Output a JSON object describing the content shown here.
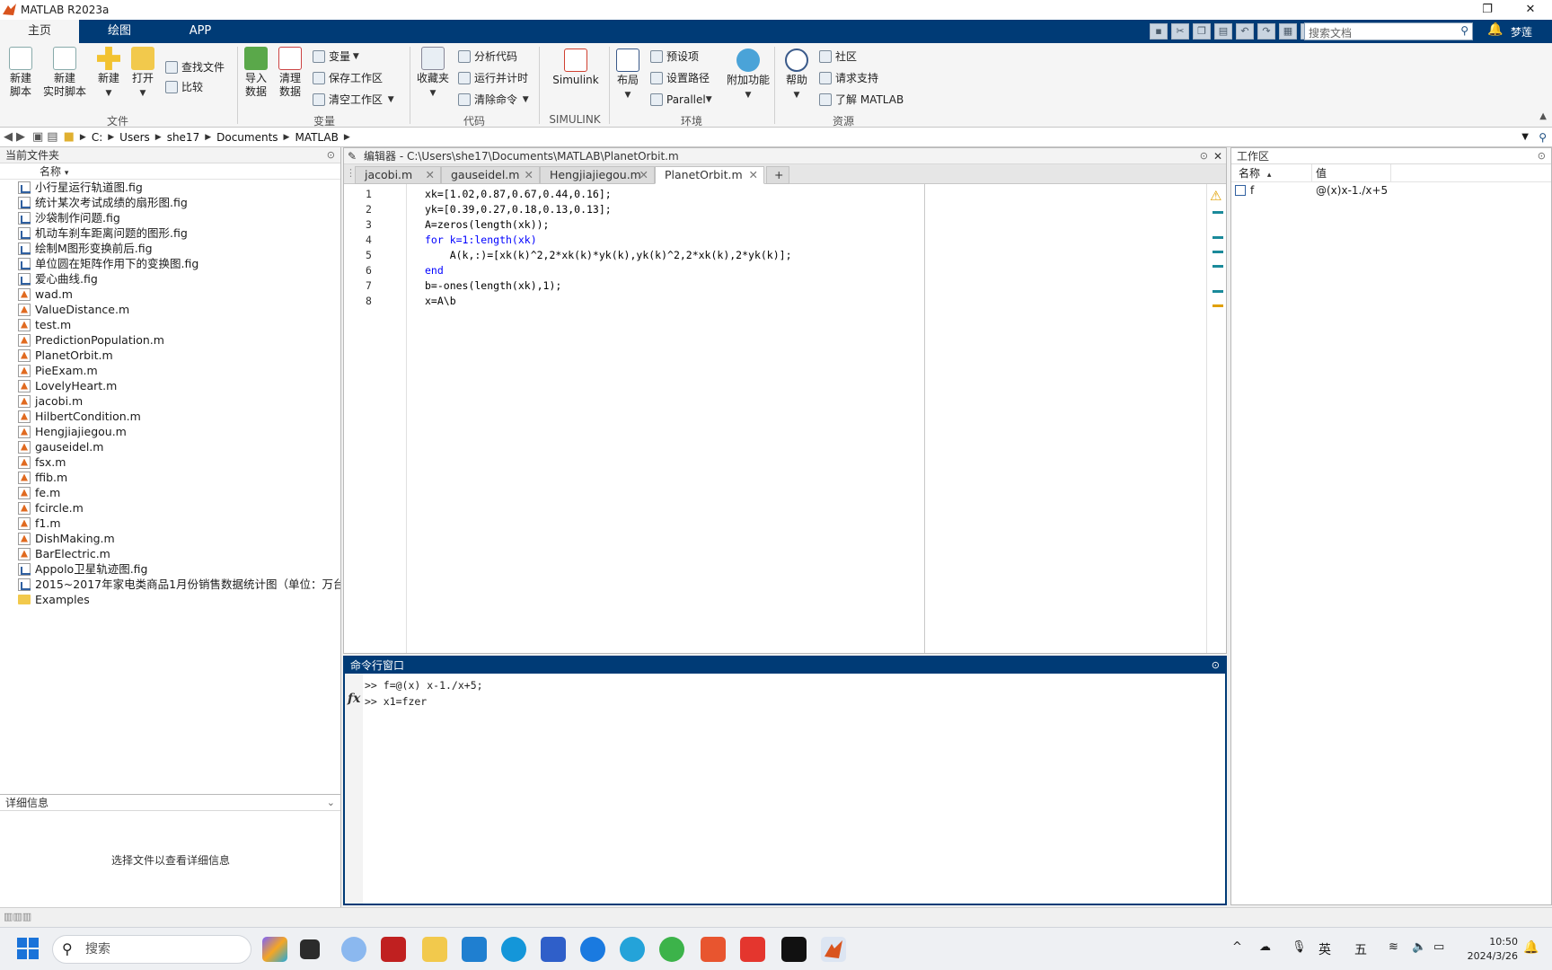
{
  "window": {
    "title": "MATLAB R2023a",
    "restore": "❐",
    "close": "✕"
  },
  "ribbon_tabs": [
    "主页",
    "绘图",
    "APP"
  ],
  "search": {
    "placeholder": "搜索文档"
  },
  "user": "梦莲",
  "ribbon": {
    "new_script": "新建\n脚本",
    "new_live_script": "新建\n实时脚本",
    "new": "新建",
    "open": "打开",
    "find_files": "查找文件",
    "compare": "比较",
    "import_data": "导入\n数据",
    "clean_data": "清理\n数据",
    "variable": "变量",
    "save_workspace": "保存工作区",
    "clear_workspace": "清空工作区",
    "favorites": "收藏夹",
    "analyze_code": "分析代码",
    "run_and_time": "运行并计时",
    "clear_commands": "清除命令",
    "simulink": "Simulink",
    "layout": "布局",
    "preferences": "预设项",
    "set_path": "设置路径",
    "parallel": "Parallel",
    "addons": "附加功能",
    "help": "帮助",
    "community": "社区",
    "request_support": "请求支持",
    "learn_matlab": "了解 MATLAB",
    "groups": {
      "file": "文件",
      "variable": "变量",
      "code": "代码",
      "simulink": "SIMULINK",
      "environment": "环境",
      "resources": "资源"
    }
  },
  "address": {
    "crumbs": [
      "C:",
      "Users",
      "she17",
      "Documents",
      "MATLAB"
    ]
  },
  "file_panel": {
    "title": "当前文件夹",
    "col_name": "名称",
    "files": [
      {
        "name": "小行星运行轨道图.fig",
        "type": "fig"
      },
      {
        "name": "统计某次考试成绩的扇形图.fig",
        "type": "fig"
      },
      {
        "name": "沙袋制作问题.fig",
        "type": "fig"
      },
      {
        "name": "机动车刹车距离问题的图形.fig",
        "type": "fig"
      },
      {
        "name": "绘制M图形变换前后.fig",
        "type": "fig"
      },
      {
        "name": "单位圆在矩阵作用下的变换图.fig",
        "type": "fig"
      },
      {
        "name": "爱心曲线.fig",
        "type": "fig"
      },
      {
        "name": "wad.m",
        "type": "m"
      },
      {
        "name": "ValueDistance.m",
        "type": "m"
      },
      {
        "name": "test.m",
        "type": "m"
      },
      {
        "name": "PredictionPopulation.m",
        "type": "m"
      },
      {
        "name": "PlanetOrbit.m",
        "type": "m"
      },
      {
        "name": "PieExam.m",
        "type": "m"
      },
      {
        "name": "LovelyHeart.m",
        "type": "m"
      },
      {
        "name": "jacobi.m",
        "type": "m"
      },
      {
        "name": "HilbertCondition.m",
        "type": "m"
      },
      {
        "name": "Hengjiajiegou.m",
        "type": "m"
      },
      {
        "name": "gauseidel.m",
        "type": "m"
      },
      {
        "name": "fsx.m",
        "type": "m"
      },
      {
        "name": "ffib.m",
        "type": "m"
      },
      {
        "name": "fe.m",
        "type": "m"
      },
      {
        "name": "fcircle.m",
        "type": "m"
      },
      {
        "name": "f1.m",
        "type": "m"
      },
      {
        "name": "DishMaking.m",
        "type": "m"
      },
      {
        "name": "BarElectric.m",
        "type": "m"
      },
      {
        "name": "Appolo卫星轨迹图.fig",
        "type": "fig"
      },
      {
        "name": "2015~2017年家电类商品1月份销售数据统计图（单位：万台...",
        "type": "fig"
      },
      {
        "name": "Examples",
        "type": "folder"
      }
    ]
  },
  "details": {
    "title": "详细信息",
    "message": "选择文件以查看详细信息"
  },
  "editor": {
    "header": "编辑器 - C:\\Users\\she17\\Documents\\MATLAB\\PlanetOrbit.m",
    "tabs": [
      "jacobi.m",
      "gauseidel.m",
      "Hengjiajiegou.m",
      "PlanetOrbit.m"
    ],
    "active_tab": "PlanetOrbit.m",
    "lines": [
      "xk=[1.02,0.87,0.67,0.44,0.16];",
      "yk=[0.39,0.27,0.18,0.13,0.13];",
      "A=zeros(length(xk));",
      "for k=1:length(xk)",
      "    A(k,:)=[xk(k)^2,2*xk(k)*yk(k),yk(k)^2,2*xk(k),2*yk(k)];",
      "end",
      "b=-ones(length(xk),1);",
      "x=A\\b"
    ]
  },
  "command_window": {
    "title": "命令行窗口",
    "lines": [
      ">> f=@(x) x-1./x+5;",
      ">> x1=fzer"
    ],
    "fx": "fx"
  },
  "workspace": {
    "title": "工作区",
    "col_name": "名称",
    "col_value": "值",
    "vars": [
      {
        "name": "f",
        "value": "@(x)x-1./x+5"
      }
    ]
  },
  "taskbar": {
    "search": "搜索",
    "clock_time": "10:50",
    "clock_date": "2024/3/26",
    "ime": "英",
    "ime2": "五"
  }
}
